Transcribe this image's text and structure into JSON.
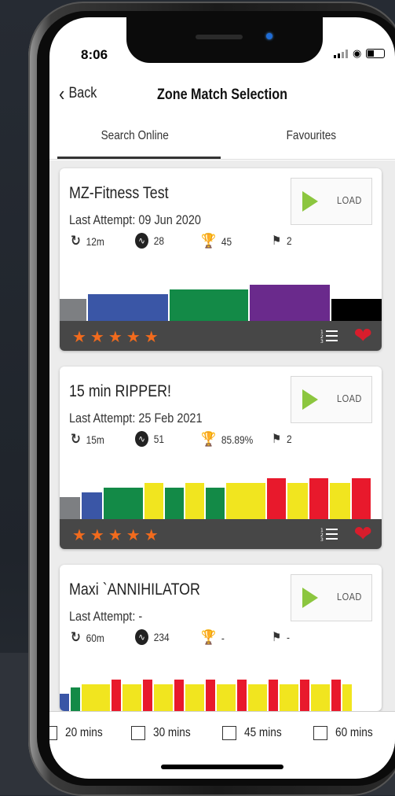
{
  "status": {
    "time": "8:06"
  },
  "nav": {
    "back_label": "Back",
    "title": "Zone Match Selection"
  },
  "tabs": [
    {
      "label": "Search Online",
      "active": true
    },
    {
      "label": "Favourites",
      "active": false
    }
  ],
  "load_label": "LOAD",
  "stars": "★★★★★",
  "colors": {
    "grey": "#7d7f82",
    "blue": "#3a56a6",
    "green": "#138a47",
    "purple": "#6a2a8c",
    "black": "#000000",
    "yellow": "#f1e51f",
    "red": "#e8192c",
    "star": "#f26b1d",
    "heart": "#d81d2c",
    "play": "#8cc63f"
  },
  "cards": [
    {
      "name": "MZ-Fitness Test",
      "last_attempt": "Last Attempt: 09 Jun 2020",
      "duration": "12m",
      "heart_rate": "28",
      "trophy": "45",
      "flags": "2"
    },
    {
      "name": "15 min RIPPER!",
      "last_attempt": "Last Attempt: 25 Feb 2021",
      "duration": "15m",
      "heart_rate": "51",
      "trophy": "85.89%",
      "flags": "2"
    },
    {
      "name": "Maxi `ANNIHILATOR",
      "last_attempt": "Last Attempt: -",
      "duration": "60m",
      "heart_rate": "234",
      "trophy": "-",
      "flags": "-"
    }
  ],
  "filters": [
    "20 mins",
    "30 mins",
    "45 mins",
    "60 mins"
  ]
}
